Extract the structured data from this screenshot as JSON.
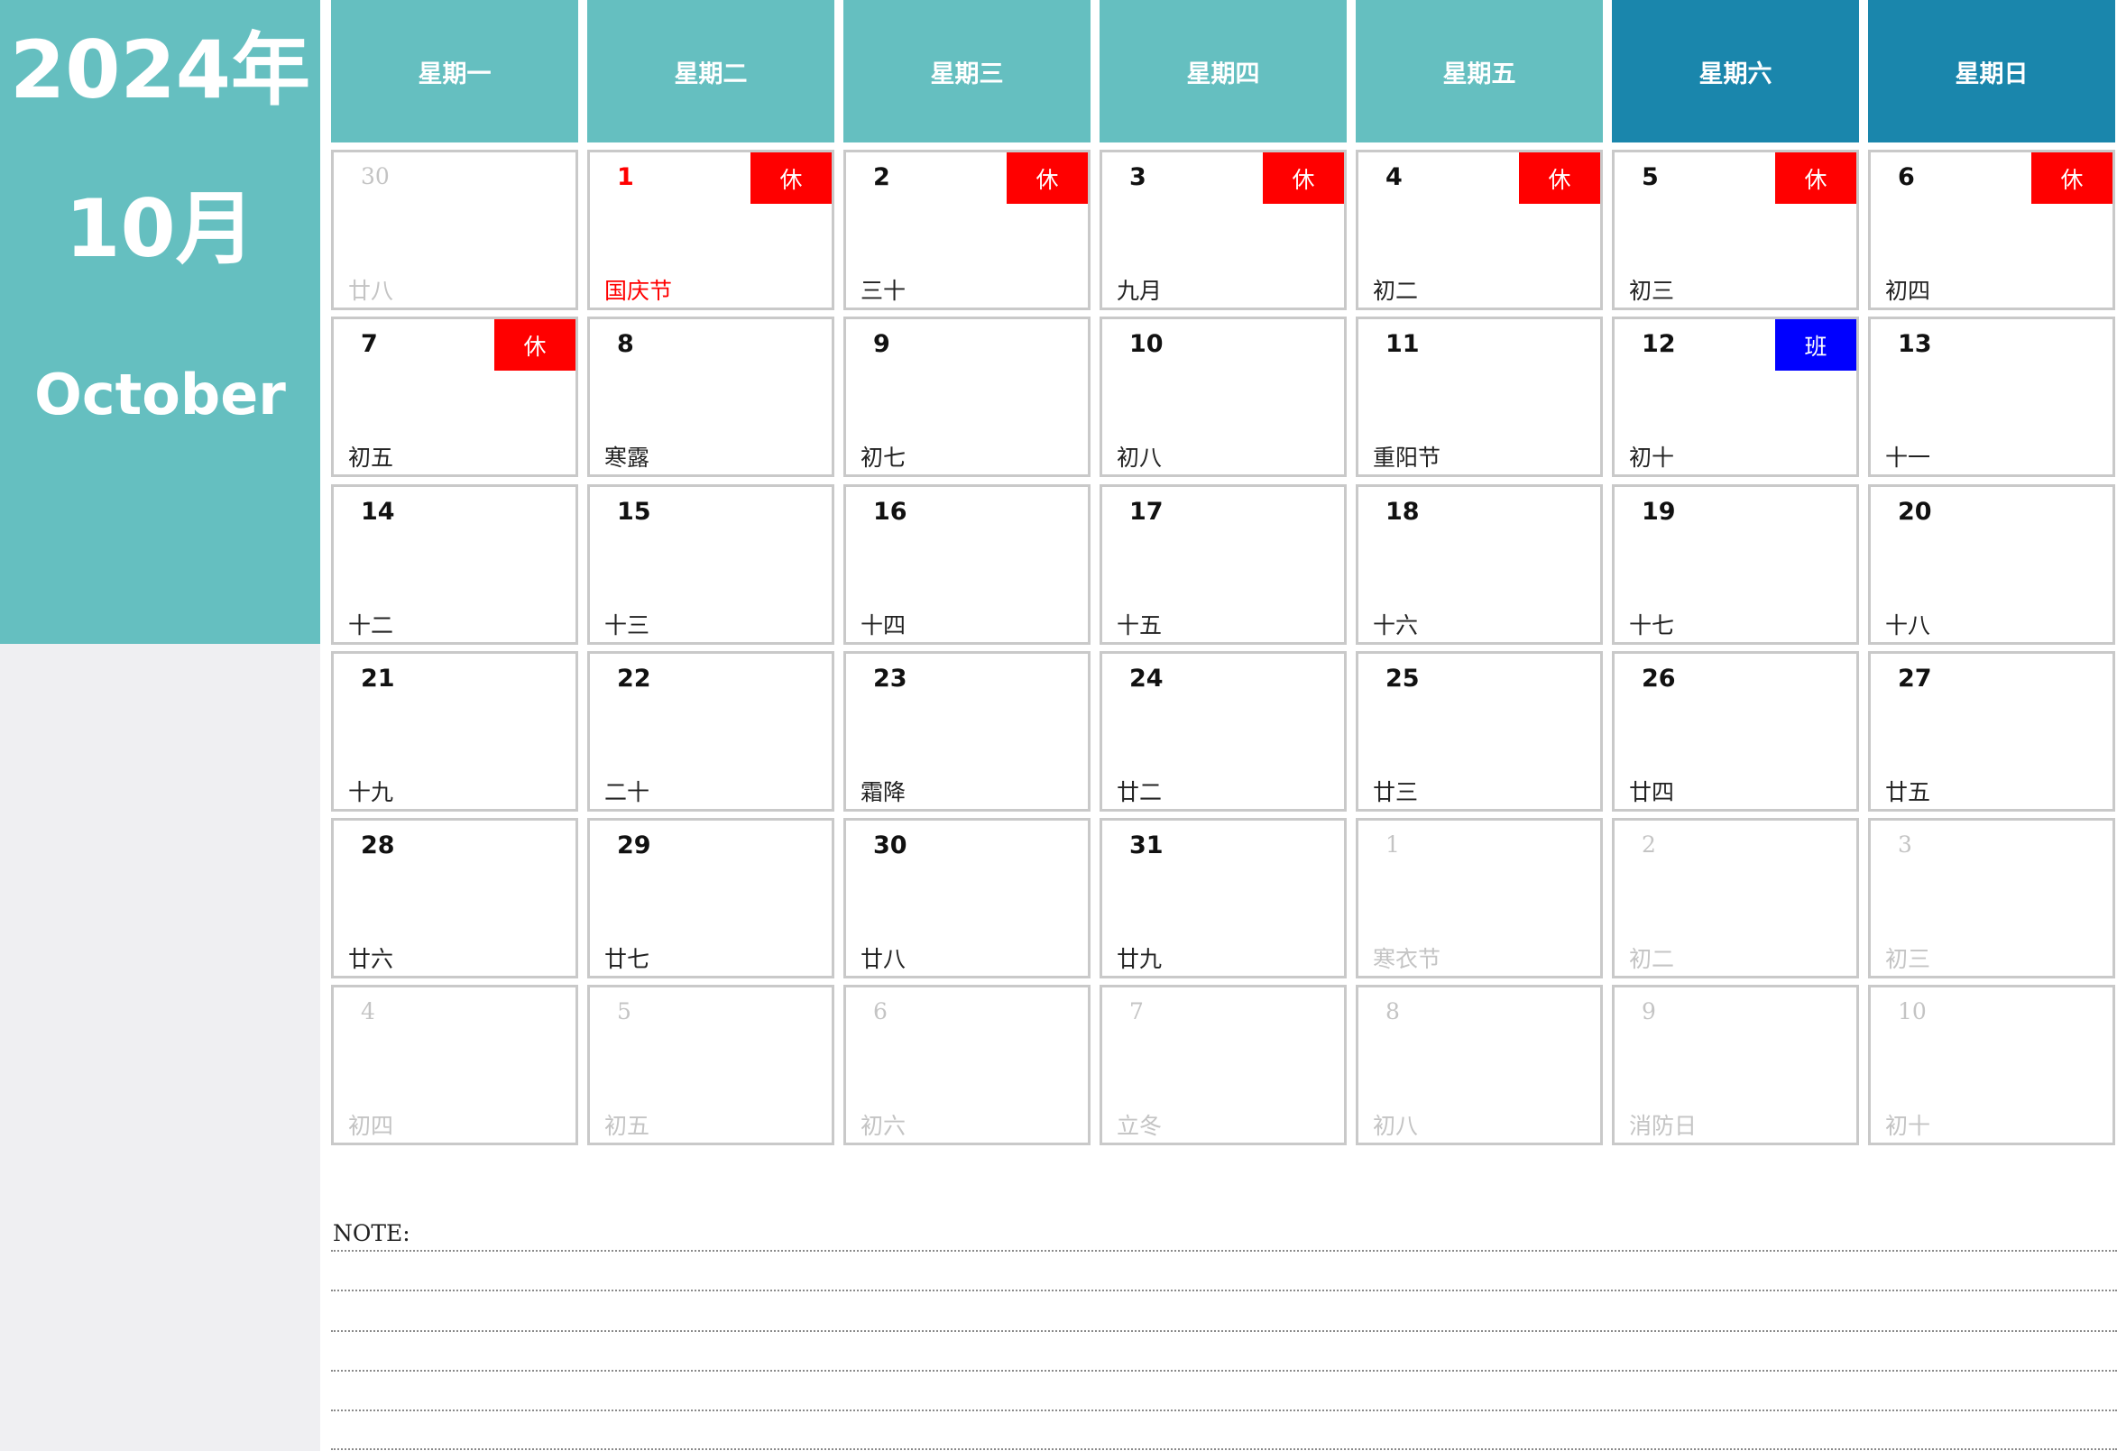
{
  "sidebar": {
    "year": "2024年",
    "month": "10月",
    "month_en": "October"
  },
  "weekdays": [
    {
      "label": "星期一",
      "weekend": false
    },
    {
      "label": "星期二",
      "weekend": false
    },
    {
      "label": "星期三",
      "weekend": false
    },
    {
      "label": "星期四",
      "weekend": false
    },
    {
      "label": "星期五",
      "weekend": false
    },
    {
      "label": "星期六",
      "weekend": true
    },
    {
      "label": "星期日",
      "weekend": true
    }
  ],
  "tags": {
    "rest": {
      "text": "休",
      "color": "#ff0000"
    },
    "work": {
      "text": "班",
      "color": "#0000ff"
    }
  },
  "days": [
    {
      "num": "30",
      "lunar": "廿八",
      "muted": true
    },
    {
      "num": "1",
      "lunar": "国庆节",
      "highlight": true,
      "tag": "rest"
    },
    {
      "num": "2",
      "lunar": "三十",
      "tag": "rest"
    },
    {
      "num": "3",
      "lunar": "九月",
      "tag": "rest"
    },
    {
      "num": "4",
      "lunar": "初二",
      "tag": "rest"
    },
    {
      "num": "5",
      "lunar": "初三",
      "tag": "rest"
    },
    {
      "num": "6",
      "lunar": "初四",
      "tag": "rest"
    },
    {
      "num": "7",
      "lunar": "初五",
      "tag": "rest"
    },
    {
      "num": "8",
      "lunar": "寒露"
    },
    {
      "num": "9",
      "lunar": "初七"
    },
    {
      "num": "10",
      "lunar": "初八"
    },
    {
      "num": "11",
      "lunar": "重阳节"
    },
    {
      "num": "12",
      "lunar": "初十",
      "tag": "work"
    },
    {
      "num": "13",
      "lunar": "十一"
    },
    {
      "num": "14",
      "lunar": "十二"
    },
    {
      "num": "15",
      "lunar": "十三"
    },
    {
      "num": "16",
      "lunar": "十四"
    },
    {
      "num": "17",
      "lunar": "十五"
    },
    {
      "num": "18",
      "lunar": "十六"
    },
    {
      "num": "19",
      "lunar": "十七"
    },
    {
      "num": "20",
      "lunar": "十八"
    },
    {
      "num": "21",
      "lunar": "十九"
    },
    {
      "num": "22",
      "lunar": "二十"
    },
    {
      "num": "23",
      "lunar": "霜降"
    },
    {
      "num": "24",
      "lunar": "廿二"
    },
    {
      "num": "25",
      "lunar": "廿三"
    },
    {
      "num": "26",
      "lunar": "廿四"
    },
    {
      "num": "27",
      "lunar": "廿五"
    },
    {
      "num": "28",
      "lunar": "廿六"
    },
    {
      "num": "29",
      "lunar": "廿七"
    },
    {
      "num": "30",
      "lunar": "廿八"
    },
    {
      "num": "31",
      "lunar": "廿九"
    },
    {
      "num": "1",
      "lunar": "寒衣节",
      "muted": true
    },
    {
      "num": "2",
      "lunar": "初二",
      "muted": true
    },
    {
      "num": "3",
      "lunar": "初三",
      "muted": true
    },
    {
      "num": "4",
      "lunar": "初四",
      "muted": true
    },
    {
      "num": "5",
      "lunar": "初五",
      "muted": true
    },
    {
      "num": "6",
      "lunar": "初六",
      "muted": true
    },
    {
      "num": "7",
      "lunar": "立冬",
      "muted": true
    },
    {
      "num": "8",
      "lunar": "初八",
      "muted": true
    },
    {
      "num": "9",
      "lunar": "消防日",
      "muted": true
    },
    {
      "num": "10",
      "lunar": "初十",
      "muted": true
    }
  ],
  "note": {
    "label": "NOTE:"
  }
}
